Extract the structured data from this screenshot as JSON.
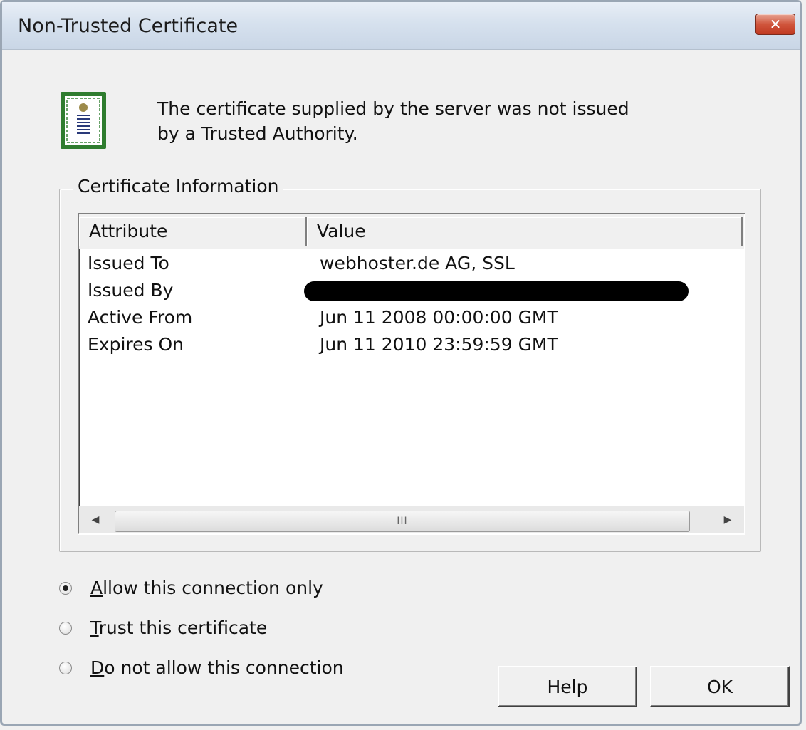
{
  "window": {
    "title": "Non-Trusted Certificate",
    "close_label": "✕"
  },
  "message": {
    "line1": "The certificate supplied by the server was not issued",
    "line2": "by a Trusted Authority."
  },
  "certificate_info": {
    "group_label": "Certificate Information",
    "columns": [
      "Attribute",
      "Value"
    ],
    "rows": [
      {
        "attribute": "Issued To",
        "value": "webhoster.de AG, SSL"
      },
      {
        "attribute": "Issued By",
        "value": ""
      },
      {
        "attribute": "Active From",
        "value": "Jun 11 2008 00:00:00 GMT"
      },
      {
        "attribute": "Expires On",
        "value": "Jun 11 2010 23:59:59 GMT"
      }
    ],
    "scrollbar": {
      "left_arrow": "◀",
      "right_arrow": "▶",
      "grip": "III"
    }
  },
  "options": {
    "allow_first": "A",
    "allow_rest": "llow this connection only",
    "trust_first": "T",
    "trust_rest": "rust this certificate",
    "deny_first": "D",
    "deny_rest": "o not allow this connection",
    "selected": "allow"
  },
  "buttons": {
    "help": "Help",
    "ok": "OK"
  }
}
